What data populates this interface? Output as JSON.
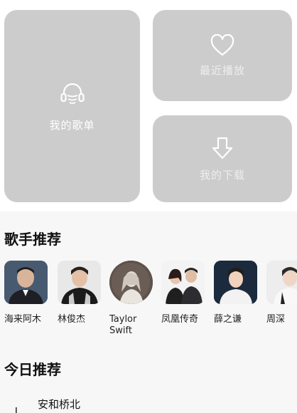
{
  "cards": {
    "my_playlist": {
      "label": "我的歌单",
      "icon": "headphones-icon"
    },
    "recent_play": {
      "label": "最近播放",
      "icon": "heart-icon"
    },
    "my_download": {
      "label": "我的下载",
      "icon": "download-arrow-icon"
    }
  },
  "sections": {
    "singers_title": "歌手推荐",
    "today_title": "今日推荐"
  },
  "artists": [
    {
      "name": "海来阿木"
    },
    {
      "name": "林俊杰"
    },
    {
      "name": "Taylor Swift"
    },
    {
      "name": "凤凰传奇"
    },
    {
      "name": "薛之谦"
    },
    {
      "name": "周深"
    }
  ],
  "today": {
    "first_song": {
      "title": "安和桥北"
    }
  },
  "colors": {
    "card_bg": "#cccccc",
    "page_bg": "#f7f7f7",
    "top_bg": "#ffffff"
  }
}
